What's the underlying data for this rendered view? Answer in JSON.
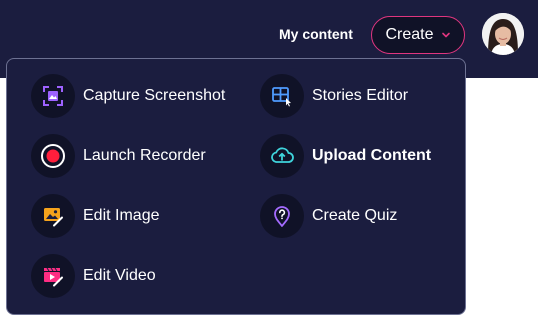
{
  "header": {
    "my_content_label": "My content",
    "create_label": "Create",
    "accent_color": "#e0357f",
    "background_color": "#1b1d3f"
  },
  "menu": {
    "items": [
      {
        "label": "Capture Screenshot",
        "icon": "capture-screenshot-icon"
      },
      {
        "label": "Stories Editor",
        "icon": "stories-editor-icon"
      },
      {
        "label": "Launch Recorder",
        "icon": "record-icon"
      },
      {
        "label": "Upload Content",
        "icon": "cloud-upload-icon"
      },
      {
        "label": "Edit Image",
        "icon": "edit-image-icon"
      },
      {
        "label": "Create Quiz",
        "icon": "quiz-icon"
      },
      {
        "label": "Edit Video",
        "icon": "edit-video-icon"
      }
    ]
  }
}
